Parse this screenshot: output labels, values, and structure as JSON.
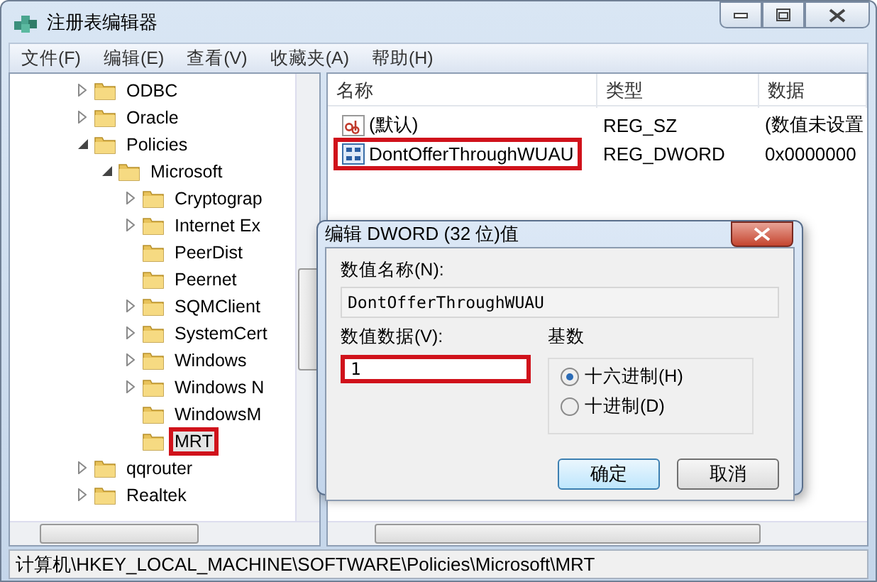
{
  "window": {
    "title": "注册表编辑器"
  },
  "menu": [
    "文件(F)",
    "编辑(E)",
    "查看(V)",
    "收藏夹(A)",
    "帮助(H)"
  ],
  "tree": [
    {
      "label": "ODBC",
      "expandable": true,
      "expanded": false,
      "selected": false,
      "highlighted": false
    },
    {
      "label": "Oracle",
      "expandable": true,
      "expanded": false,
      "selected": false,
      "highlighted": false
    },
    {
      "label": "Policies",
      "expandable": true,
      "expanded": true,
      "selected": false,
      "highlighted": false,
      "children": [
        {
          "label": "Microsoft",
          "expandable": true,
          "expanded": true,
          "selected": false,
          "highlighted": false,
          "children": [
            {
              "label": "Cryptograp",
              "expandable": true,
              "expanded": false,
              "selected": false,
              "highlighted": false
            },
            {
              "label": "Internet Ex",
              "expandable": true,
              "expanded": false,
              "selected": false,
              "highlighted": false
            },
            {
              "label": "PeerDist",
              "expandable": false,
              "selected": false,
              "highlighted": false
            },
            {
              "label": "Peernet",
              "expandable": false,
              "selected": false,
              "highlighted": false
            },
            {
              "label": "SQMClient",
              "expandable": true,
              "expanded": false,
              "selected": false,
              "highlighted": false
            },
            {
              "label": "SystemCert",
              "expandable": true,
              "expanded": false,
              "selected": false,
              "highlighted": false
            },
            {
              "label": "Windows",
              "expandable": true,
              "expanded": false,
              "selected": false,
              "highlighted": false
            },
            {
              "label": "Windows N",
              "expandable": true,
              "expanded": false,
              "selected": false,
              "highlighted": false
            },
            {
              "label": "WindowsM",
              "expandable": false,
              "selected": false,
              "highlighted": false
            },
            {
              "label": "MRT",
              "expandable": false,
              "selected": true,
              "highlighted": true
            }
          ]
        }
      ]
    },
    {
      "label": "qqrouter",
      "expandable": true,
      "expanded": false,
      "selected": false,
      "highlighted": false
    },
    {
      "label": "Realtek",
      "expandable": true,
      "expanded": false,
      "selected": false,
      "highlighted": false
    }
  ],
  "values": {
    "columns": [
      "名称",
      "类型",
      "数据"
    ],
    "rows": [
      {
        "kind": "string",
        "name": "(默认)",
        "type": "REG_SZ",
        "data": "(数值未设置",
        "highlighted": false
      },
      {
        "kind": "binary",
        "name": "DontOfferThroughWUAU",
        "type": "REG_DWORD",
        "data": "0x0000000",
        "highlighted": true
      }
    ]
  },
  "dialog": {
    "title": "编辑 DWORD (32 位)值",
    "name_label": "数值名称(N):",
    "name_value": "DontOfferThroughWUAU",
    "data_label": "数值数据(V):",
    "data_value": "1",
    "data_highlighted": true,
    "base_label": "基数",
    "bases": [
      {
        "label": "十六进制(H)",
        "selected": true
      },
      {
        "label": "十进制(D)",
        "selected": false
      }
    ],
    "buttons": [
      {
        "label": "确定",
        "default": true
      },
      {
        "label": "取消",
        "default": false
      }
    ]
  },
  "status_bar": "计算机\\HKEY_LOCAL_MACHINE\\SOFTWARE\\Policies\\Microsoft\\MRT"
}
